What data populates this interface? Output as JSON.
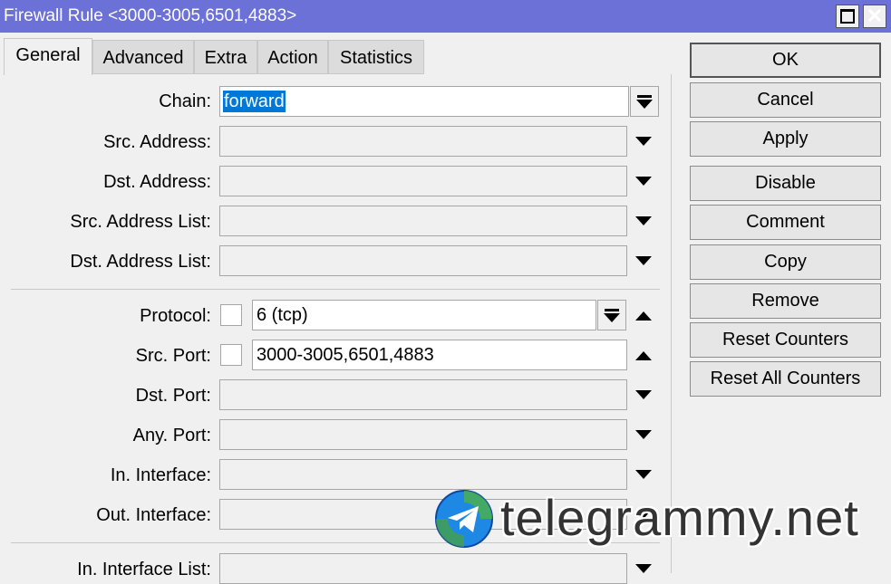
{
  "window": {
    "title": "Firewall Rule <3000-3005,6501,4883>"
  },
  "tabs": [
    {
      "label": "General"
    },
    {
      "label": "Advanced"
    },
    {
      "label": "Extra"
    },
    {
      "label": "Action"
    },
    {
      "label": "Statistics"
    }
  ],
  "active_tab": "General",
  "form": {
    "chain": {
      "label": "Chain:",
      "value": "forward"
    },
    "src_address": {
      "label": "Src. Address:",
      "value": ""
    },
    "dst_address": {
      "label": "Dst. Address:",
      "value": ""
    },
    "src_address_list": {
      "label": "Src. Address List:",
      "value": ""
    },
    "dst_address_list": {
      "label": "Dst. Address List:",
      "value": ""
    },
    "protocol": {
      "label": "Protocol:",
      "value": "6 (tcp)",
      "negate": false
    },
    "src_port": {
      "label": "Src. Port:",
      "value": "3000-3005,6501,4883",
      "negate": false
    },
    "dst_port": {
      "label": "Dst. Port:",
      "value": ""
    },
    "any_port": {
      "label": "Any. Port:",
      "value": ""
    },
    "in_interface": {
      "label": "In. Interface:",
      "value": ""
    },
    "out_interface": {
      "label": "Out. Interface:",
      "value": ""
    },
    "in_interface_list": {
      "label": "In. Interface List:",
      "value": ""
    }
  },
  "buttons": {
    "ok": "OK",
    "cancel": "Cancel",
    "apply": "Apply",
    "disable": "Disable",
    "comment": "Comment",
    "copy": "Copy",
    "remove": "Remove",
    "reset_counters": "Reset Counters",
    "reset_all_counters": "Reset All Counters"
  },
  "watermark": {
    "text": "telegrammy.net",
    "icon": "telegram-logo-icon"
  },
  "colors": {
    "titlebar": "#6c71d8",
    "selection": "#0078d7",
    "panel": "#f0f0f0"
  }
}
